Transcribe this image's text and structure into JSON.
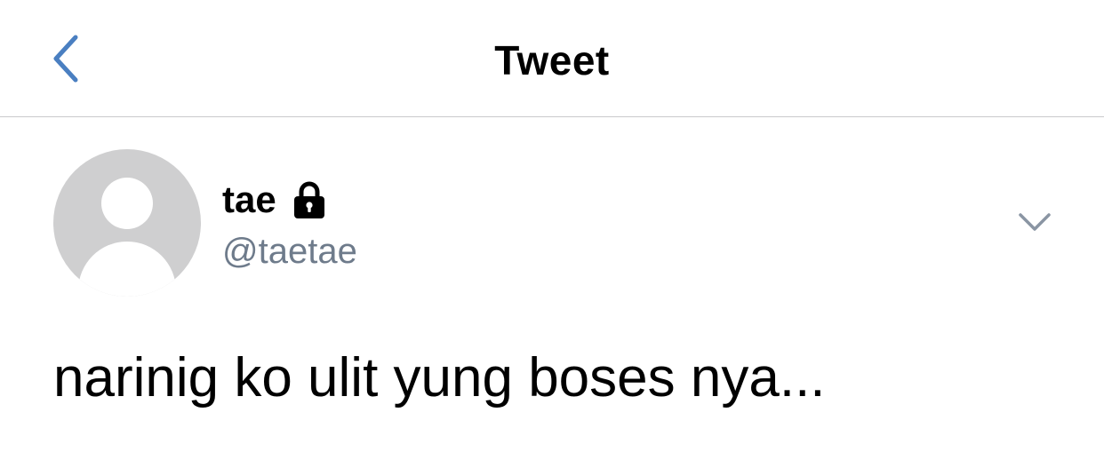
{
  "header": {
    "title": "Tweet",
    "back_icon": "chevron-left-icon",
    "accent_color": "#4a7fc1"
  },
  "tweet": {
    "author": {
      "display_name": "tae",
      "handle": "@taetae",
      "protected_icon": "lock-icon",
      "avatar": "default-avatar"
    },
    "menu_icon": "chevron-down-icon",
    "text": "narinig ko ulit yung boses nya..."
  }
}
